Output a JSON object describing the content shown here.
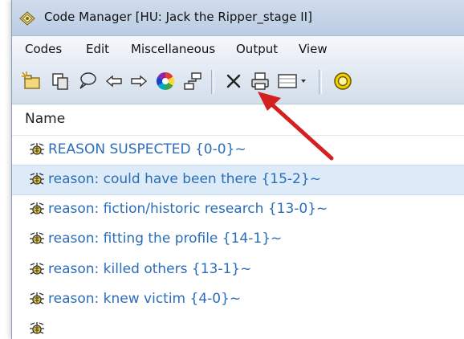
{
  "window": {
    "title": "Code Manager [HU: Jack the Ripper_stage II]"
  },
  "menu": {
    "items": [
      "Codes",
      "Edit",
      "Miscellaneous",
      "Output",
      "View"
    ]
  },
  "toolbar": {
    "buttons": [
      {
        "icon": "new-code-icon"
      },
      {
        "icon": "copy-icon"
      },
      {
        "icon": "comment-bubble-icon"
      },
      {
        "icon": "arrow-left-icon"
      },
      {
        "icon": "arrow-right-icon"
      },
      {
        "icon": "color-wheel-icon"
      },
      {
        "icon": "network-view-icon"
      },
      {
        "icon": "delete-icon"
      },
      {
        "icon": "print-icon"
      },
      {
        "icon": "view-options-dropdown-icon"
      },
      {
        "icon": "code-family-icon"
      }
    ]
  },
  "list": {
    "column_header": "Name",
    "rows": [
      {
        "label": "REASON SUSPECTED {0-0}~",
        "selected": false
      },
      {
        "label": "reason: could have been there {15-2}~",
        "selected": true
      },
      {
        "label": "reason: fiction/historic research {13-0}~",
        "selected": false
      },
      {
        "label": "reason: fitting the profile {14-1}~",
        "selected": false
      },
      {
        "label": "reason: killed others {13-1}~",
        "selected": false
      },
      {
        "label": "reason: knew victim {4-0}~",
        "selected": false
      }
    ]
  },
  "colors": {
    "code_text": "#2a6db8",
    "selection": "#dcebf7",
    "annotation_arrow": "#d32020"
  }
}
